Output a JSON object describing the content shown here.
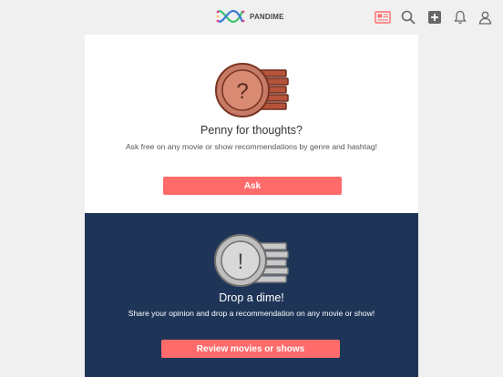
{
  "header": {
    "brand": "PANDIME",
    "icons": [
      "newspaper-icon",
      "search-icon",
      "plus-square-icon",
      "bell-icon",
      "user-icon"
    ],
    "accent_color": "#ff6b6b"
  },
  "ask_card": {
    "title": "Penny for thoughts?",
    "description": "Ask free on any movie or show recommendations by genre and hashtag!",
    "button_label": "Ask",
    "coin_symbol": "?",
    "background": "#ffffff"
  },
  "drop_card": {
    "title": "Drop a dime!",
    "description": "Share your opinion and drop a recommendation on any movie or show!",
    "button_label": "Review movies or shows",
    "coin_symbol": "!",
    "background": "#1f3558"
  }
}
